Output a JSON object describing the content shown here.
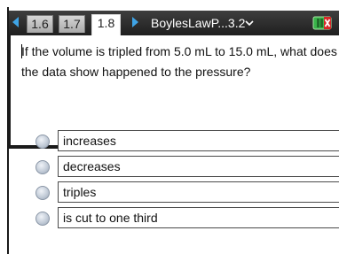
{
  "tabs": [
    {
      "label": "1.6",
      "active": false
    },
    {
      "label": "1.7",
      "active": false
    },
    {
      "label": "1.8",
      "active": true
    }
  ],
  "document_title": "BoylesLawP...3.2",
  "question": {
    "text": "If the volume is tripled from 5.0 mL to 15.0 mL, what does the data show happened to the pressure?"
  },
  "choices": [
    {
      "label": "increases"
    },
    {
      "label": "decreases"
    },
    {
      "label": "triples"
    },
    {
      "label": "is cut to one third"
    }
  ],
  "colors": {
    "titlebar": "#2a2a2a",
    "nav_arrow": "#3fa4e6",
    "battery_green": "#39b54a",
    "close_red": "#d62828"
  },
  "icons": {
    "prev": "nav-left-icon",
    "next": "nav-right-icon",
    "dropdown": "chevron-down-icon",
    "battery": "battery-icon"
  }
}
